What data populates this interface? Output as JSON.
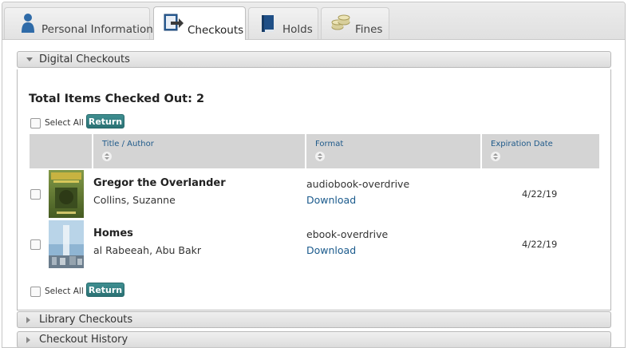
{
  "tabs": [
    {
      "label": "Personal Information",
      "icon": "person-icon",
      "active": false
    },
    {
      "label": "Checkouts",
      "icon": "checkout-icon",
      "active": true
    },
    {
      "label": "Holds",
      "icon": "book-icon",
      "active": false
    },
    {
      "label": "Fines",
      "icon": "coins-icon",
      "active": false
    }
  ],
  "digital": {
    "title": "Digital Checkouts",
    "total_label": "Total Items Checked Out: 2",
    "select_all": "Select All",
    "return_label": "Return",
    "columns": [
      "Title / Author",
      "Format",
      "Expiration Date"
    ],
    "items": [
      {
        "title": "Gregor the Overlander",
        "author": "Collins, Suzanne",
        "format": "audiobook-overdrive",
        "action": "Download",
        "expiration": "4/22/19",
        "cover_text": "GREGOR OVERLANDER"
      },
      {
        "title": "Homes",
        "author": "al Rabeeah, Abu Bakr",
        "format": "ebook-overdrive",
        "action": "Download",
        "expiration": "4/22/19",
        "cover_text": "HOMES"
      }
    ]
  },
  "sections": [
    {
      "title": "Library Checkouts"
    },
    {
      "title": "Checkout History"
    }
  ],
  "colors": {
    "accent": "#2e7577",
    "link": "#1a5a8c",
    "header_bg": "#d4d4d4"
  }
}
